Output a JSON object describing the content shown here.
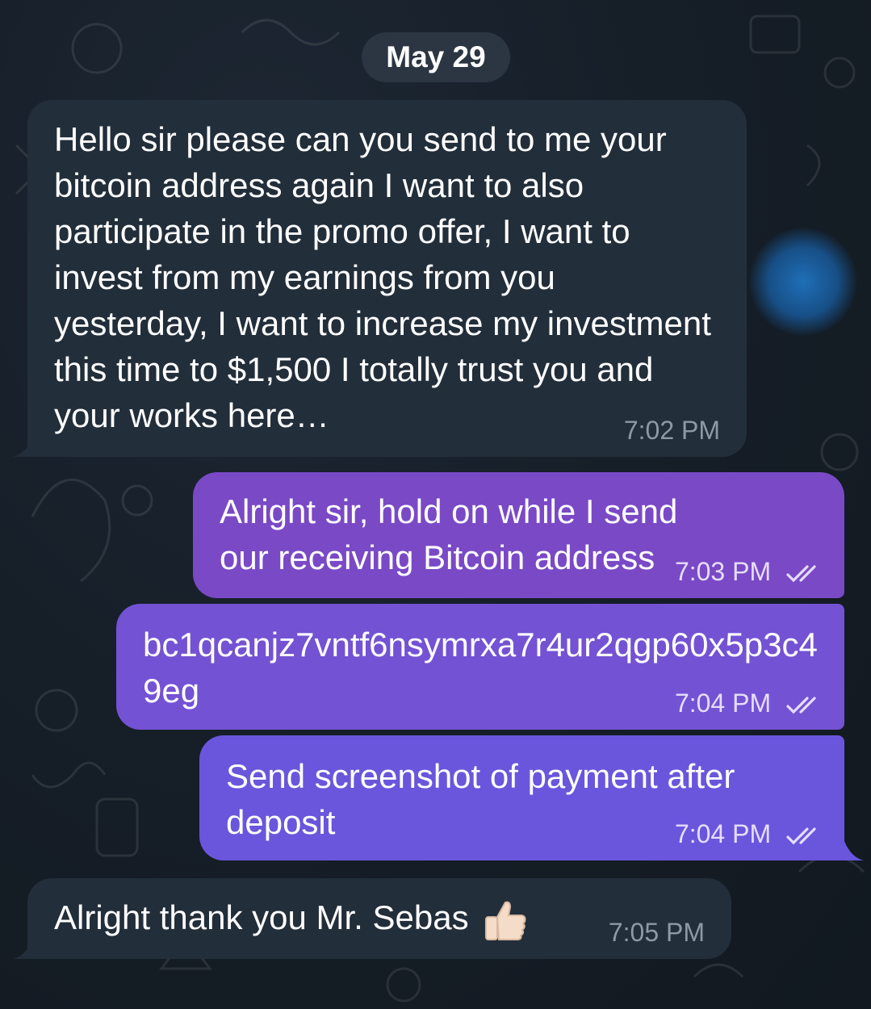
{
  "chat": {
    "date_label": "May 29",
    "messages": [
      {
        "direction": "incoming",
        "text": "Hello sir please can you send to me your bitcoin address again I want to also participate in the promo offer, I want to invest from my earnings from you yesterday, I want to increase my investment this time to $1,500 I totally trust you and your works here…",
        "time": "7:02 PM"
      },
      {
        "direction": "outgoing",
        "text": "Alright sir, hold on while I send our receiving Bitcoin address",
        "time": "7:03 PM",
        "status": "read"
      },
      {
        "direction": "outgoing",
        "text": "bc1qcanjz7vntf6nsymrxa7r4ur2qgp60x5p3c49eg",
        "time": "7:04 PM",
        "status": "read"
      },
      {
        "direction": "outgoing",
        "text": "Send screenshot of payment after deposit",
        "time": "7:04 PM",
        "status": "read"
      },
      {
        "direction": "incoming",
        "text": "Alright thank you Mr. Sebas",
        "emoji": "thumbs-up-light-skin-tone",
        "time": "7:05 PM"
      }
    ]
  },
  "colors": {
    "background": "#161e27",
    "incoming_bubble": "#222e3a",
    "outgoing_bubble": "#7a49c6",
    "outgoing_bubble_alt": "#6a56dc",
    "date_pill": "#2b3642",
    "timestamp_incoming": "#8d99a6",
    "timestamp_outgoing": "#e6ddfa"
  },
  "icons": [
    "double-check-icon",
    "thumbs-up-emoji"
  ]
}
